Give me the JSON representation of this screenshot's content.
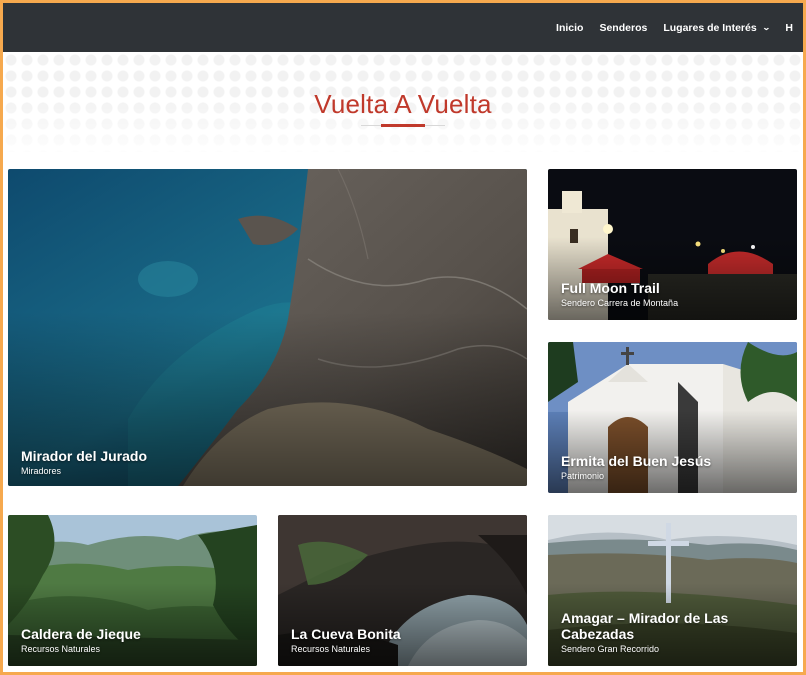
{
  "nav": {
    "items": [
      {
        "label": "Inicio"
      },
      {
        "label": "Senderos"
      },
      {
        "label": "Lugares de Interés",
        "has_dropdown": true
      },
      {
        "label": "H"
      }
    ]
  },
  "page": {
    "title": "Vuelta A Vuelta",
    "accent_color": "#c0392b",
    "frame_color": "#f6a94e"
  },
  "cards": [
    {
      "title": "Mirador del Jurado",
      "category": "Miradores"
    },
    {
      "title": "Full Moon Trail",
      "category": "Sendero Carrera de Montaña"
    },
    {
      "title": "Ermita del Buen Jesús",
      "category": "Patrimonio"
    },
    {
      "title": "Caldera de Jieque",
      "category": "Recursos Naturales"
    },
    {
      "title": "La Cueva Bonita",
      "category": "Recursos Naturales"
    },
    {
      "title": "Amagar – Mirador de Las Cabezadas",
      "category": "Sendero Gran Recorrido"
    }
  ]
}
